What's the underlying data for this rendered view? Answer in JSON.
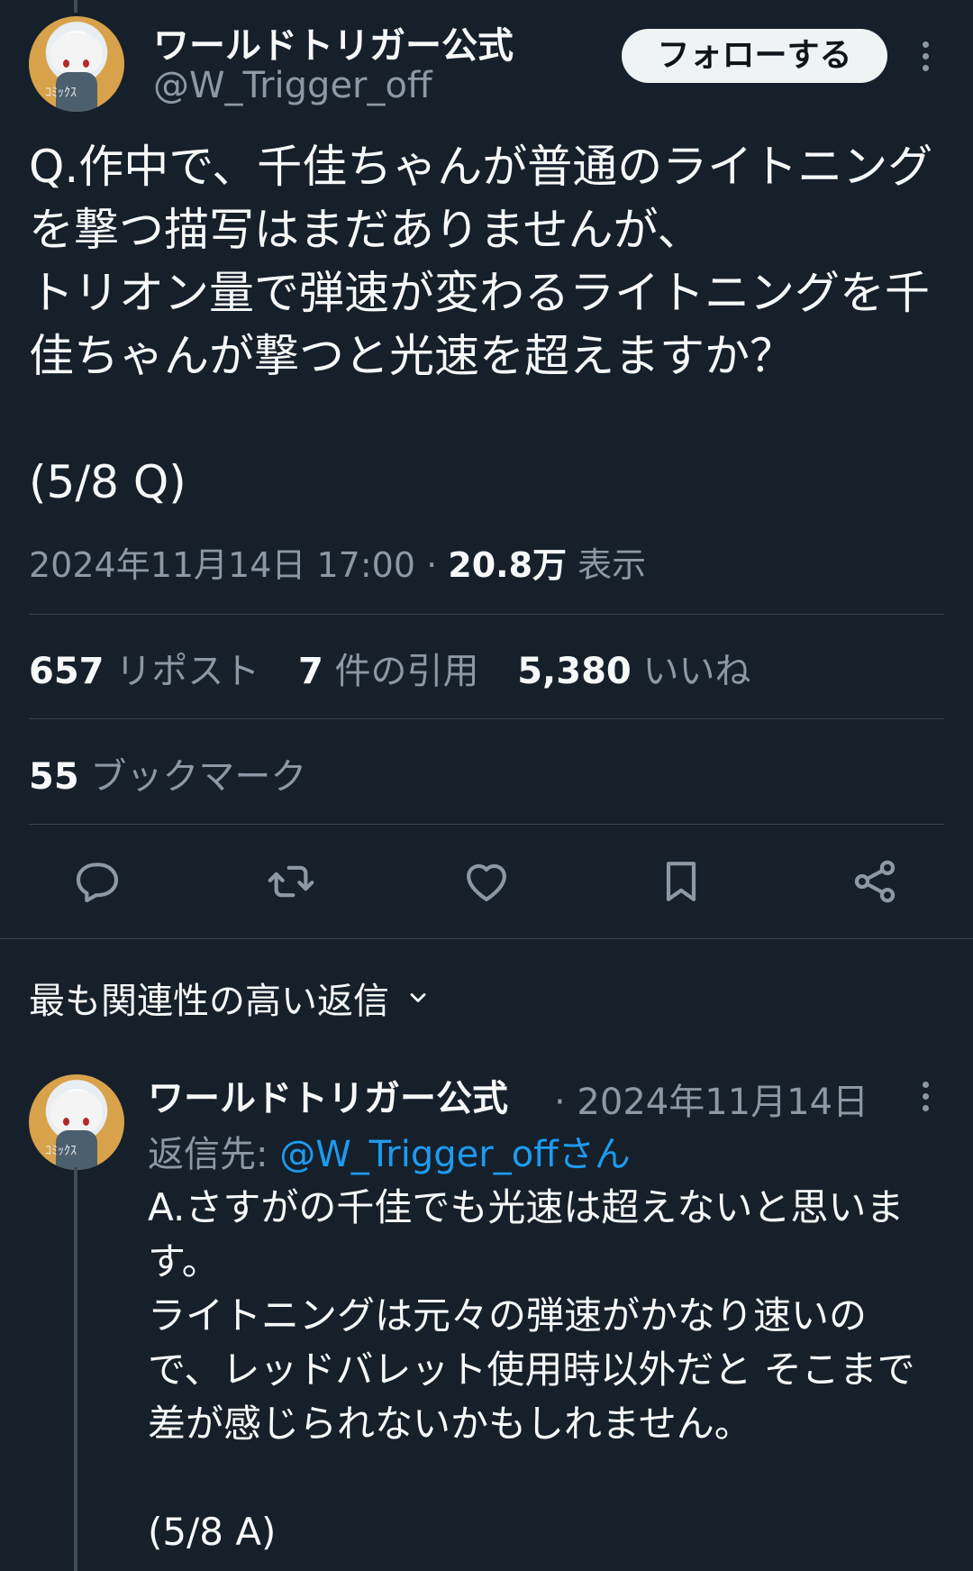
{
  "tweet": {
    "display_name": "ワールドトリガー公式",
    "handle": "@W_Trigger_off",
    "follow_label": "フォローする",
    "text": "Q.作中で、千佳ちゃんが普通のライトニングを撃つ描写はまだありませんが、\nトリオン量で弾速が変わるライトニングを千佳ちゃんが撃つと光速を超えますか？\n\n(5/8 Q)",
    "datetime": "2024年11月14日 17:00",
    "separator": "·",
    "views_count": "20.8万",
    "views_label": "表示",
    "reposts_count": "657",
    "reposts_label": "リポスト",
    "quotes_count": "7",
    "quotes_label": "件の引用",
    "likes_count": "5,380",
    "likes_label": "いいね",
    "bookmarks_count": "55",
    "bookmarks_label": "ブックマーク"
  },
  "actions": [
    "reply-icon",
    "repost-icon",
    "like-icon",
    "bookmark-icon",
    "share-icon"
  ],
  "replies_sort": {
    "label": "最も関連性の高い返信"
  },
  "reply": {
    "display_name": "ワールドトリガー公式",
    "date": "· 2024年11月14日",
    "reply_to_label": "返信先:",
    "reply_to_mention": "@W_Trigger_offさん",
    "text": "A.さすがの千佳でも光速は超えないと思います。\nライトニングは元々の弾速がかなり速いので、レッドバレット使用時以外だと そこまで差が感じられないかもしれません。\n\n(5/8 A)"
  },
  "colors": {
    "background": "#15202b",
    "text": "#f7f9f9",
    "secondary": "#8b98a5",
    "link": "#1d9bf0",
    "divider": "#38444d"
  }
}
